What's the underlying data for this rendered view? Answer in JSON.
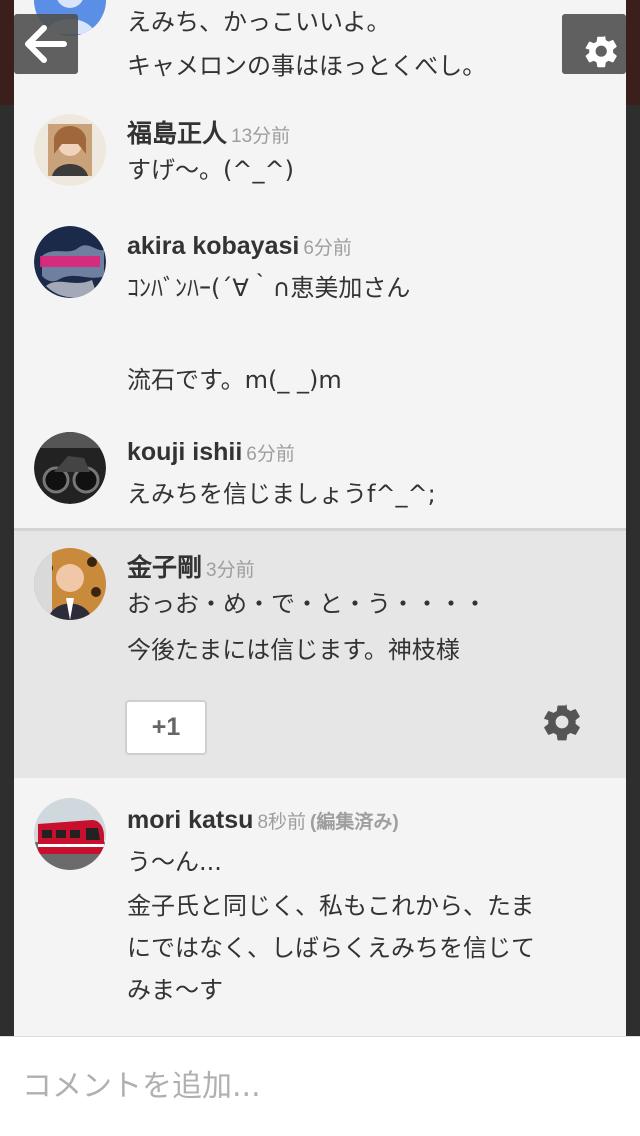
{
  "header": {
    "back_icon": "back-arrow-icon",
    "settings_icon": "gear-icon"
  },
  "comments": [
    {
      "lines": [
        "えみち、かっこいいよ。",
        "キャメロンの事はほっとくべし。"
      ]
    },
    {
      "name": "福島正人",
      "time": "13分前",
      "lines": [
        "すげ〜。(^_^)"
      ]
    },
    {
      "name": "akira kobayasi",
      "time": "6分前",
      "lines": [
        "ｺﾝﾊﾞﾝﾊｰ(´∀｀∩恵美加さん",
        "流石です。m(_ _)m"
      ]
    },
    {
      "name": "kouji ishii",
      "time": "6分前",
      "lines": [
        "えみちを信じましょうf^_^;"
      ]
    },
    {
      "name": "金子剛",
      "time": "3分前",
      "lines": [
        "おっお・め・で・と・う・・・・",
        "今後たまには信じます。神枝様"
      ]
    },
    {
      "name": "mori katsu",
      "time": "8秒前",
      "edited": "(編集済み)",
      "lines": [
        "う〜ん...",
        "金子氏と同じく、私もこれから、たま",
        "にではなく、しばらくえみちを信じて",
        "みま〜す"
      ]
    }
  ],
  "actions": {
    "plus_one": "+1",
    "gear_icon": "gear-icon"
  },
  "input": {
    "placeholder": "コメントを追加..."
  },
  "colors": {
    "panel": "#f4f4f4",
    "highlight": "#e6e6e6",
    "meta": "#9e9e9e"
  }
}
